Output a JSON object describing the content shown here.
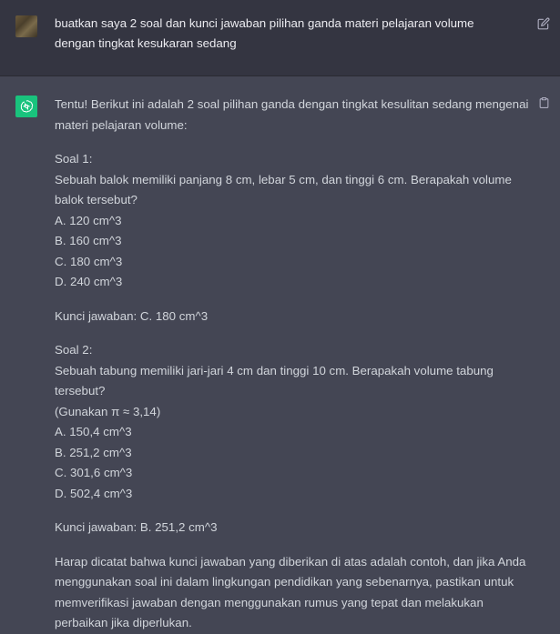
{
  "user": {
    "message": "buatkan saya 2 soal dan kunci jawaban pilihan ganda materi pelajaran volume dengan tingkat kesukaran sedang"
  },
  "assistant": {
    "intro": "Tentu! Berikut ini adalah 2 soal pilihan ganda dengan tingkat kesulitan sedang mengenai materi pelajaran volume:",
    "soal1": {
      "title": "Soal 1:",
      "question": "Sebuah balok memiliki panjang 8 cm, lebar 5 cm, dan tinggi 6 cm. Berapakah volume balok tersebut?",
      "a": "A. 120 cm^3",
      "b": "B. 160 cm^3",
      "c": "C. 180 cm^3",
      "d": "D. 240 cm^3",
      "key": "Kunci jawaban: C. 180 cm^3"
    },
    "soal2": {
      "title": "Soal 2:",
      "question": "Sebuah tabung memiliki jari-jari 4 cm dan tinggi 10 cm. Berapakah volume tabung tersebut?",
      "note": "(Gunakan π ≈ 3,14)",
      "a": "A. 150,4 cm^3",
      "b": "B. 251,2 cm^3",
      "c": "C. 301,6 cm^3",
      "d": "D. 502,4 cm^3",
      "key": "Kunci jawaban: B. 251,2 cm^3"
    },
    "closing": "Harap dicatat bahwa kunci jawaban yang diberikan di atas adalah contoh, dan jika Anda menggunakan soal ini dalam lingkungan pendidikan yang sebenarnya, pastikan untuk memverifikasi jawaban dengan menggunakan rumus yang tepat dan melakukan perbaikan jika diperlukan."
  },
  "icons": {
    "edit": "edit-icon",
    "copy": "clipboard-icon",
    "assistant_logo": "openai-logo-icon"
  },
  "colors": {
    "user_bg": "#343541",
    "assistant_bg": "#444654",
    "bot_avatar": "#19c37d"
  }
}
